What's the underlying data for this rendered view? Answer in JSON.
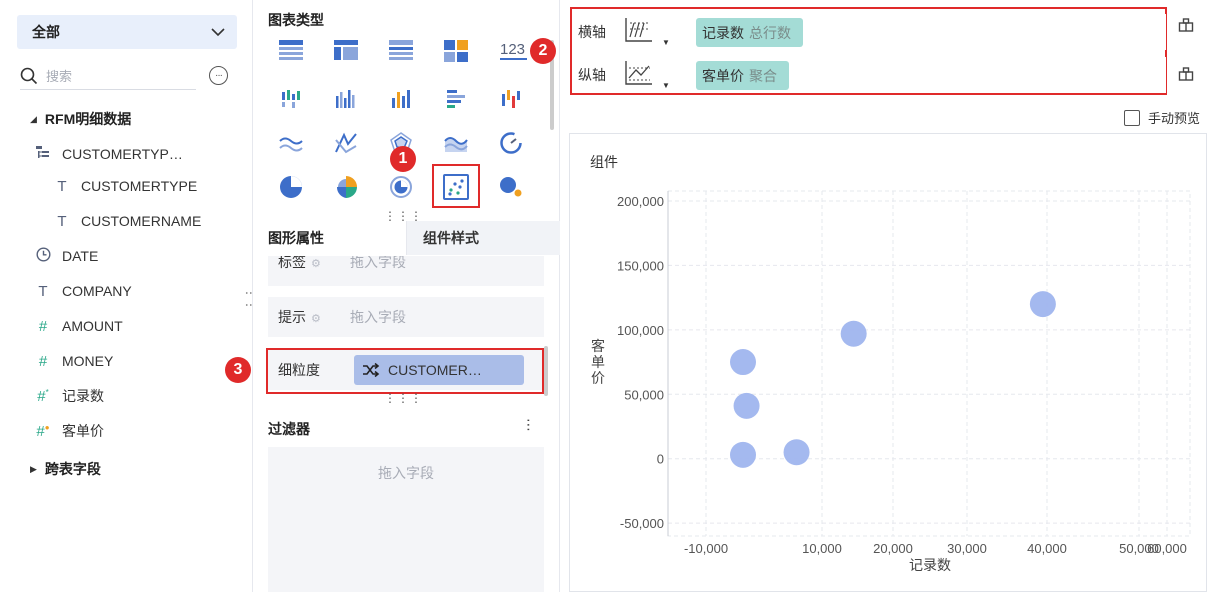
{
  "left_panel": {
    "scope_label": "全部",
    "search_placeholder": "搜索",
    "dataset": "RFM明细数据",
    "fields": [
      {
        "label": "CUSTOMERTYP…",
        "icon": "hierarchy-icon"
      },
      {
        "label": "CUSTOMERTYPE",
        "icon": "text-field-icon"
      },
      {
        "label": "CUSTOMERNAME",
        "icon": "text-field-icon"
      },
      {
        "label": "DATE",
        "icon": "date-field-icon"
      },
      {
        "label": "COMPANY",
        "icon": "text-field-icon"
      },
      {
        "label": "AMOUNT",
        "icon": "number-field-icon"
      },
      {
        "label": "MONEY",
        "icon": "number-field-icon"
      },
      {
        "label": "记录数",
        "icon": "record-count-icon"
      },
      {
        "label": "客单价",
        "icon": "calculated-field-icon"
      }
    ],
    "cross_table": "跨表字段"
  },
  "middle_panel": {
    "chart_type_title": "图表类型",
    "graphic_props_tab": "图形属性",
    "component_style_tab": "组件样式",
    "label_row": {
      "label": "标签",
      "placeholder": "拖入字段"
    },
    "tooltip_row": {
      "label": "提示",
      "placeholder": "拖入字段"
    },
    "granularity_row": {
      "label": "细粒度",
      "value": "CUSTOMER…"
    },
    "filter_title": "过滤器",
    "filter_placeholder": "拖入字段",
    "badges": [
      "1",
      "2",
      "3"
    ]
  },
  "axis_config": {
    "x_label": "横轴",
    "x_field": "记录数",
    "x_agg": "总行数",
    "y_label": "纵轴",
    "y_field": "客单价",
    "y_agg": "聚合",
    "manual_preview": "手动预览"
  },
  "component_title": "组件",
  "chart_data": {
    "type": "scatter",
    "xlabel": "记录数",
    "ylabel": "客单价",
    "x_ticks": [
      "-10,000",
      "10,000",
      "20,000",
      "30,000",
      "40,000",
      "50,000",
      "60,000"
    ],
    "y_ticks": [
      "200,000",
      "150,000",
      "100,000",
      "50,000",
      "0",
      "-50,000"
    ],
    "point_color": "#9fb5ee",
    "points": [
      {
        "x": 0,
        "y": 75000
      },
      {
        "x": 500,
        "y": 41000
      },
      {
        "x": 0,
        "y": 3000
      },
      {
        "x": 7500,
        "y": 5000
      },
      {
        "x": 15500,
        "y": 97000
      },
      {
        "x": 42000,
        "y": 120000
      }
    ]
  }
}
